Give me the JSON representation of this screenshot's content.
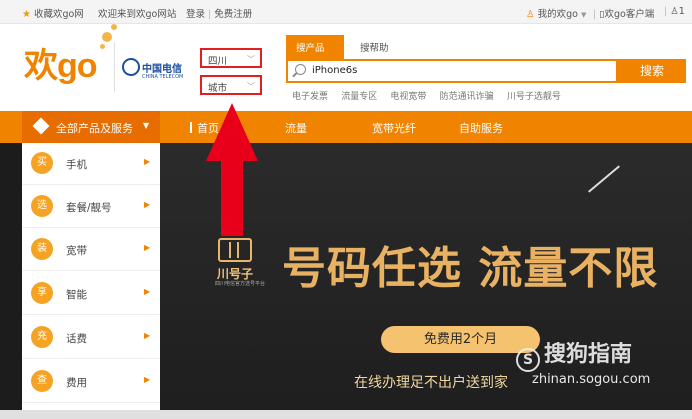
{
  "topbar": {
    "favorite": "收藏欢go网",
    "welcome": "欢迎来到欢go网站",
    "login": "登录",
    "register": "免费注册",
    "my_account": "我的欢go",
    "client": "欢go客户端",
    "right_fragment": "1"
  },
  "header": {
    "logo_text": "欢go",
    "telecom_cn": "中国电信",
    "telecom_en": "CHINA TELECOM",
    "province": "四川",
    "city": "城市"
  },
  "search": {
    "tabs": [
      "搜产品",
      "搜帮助"
    ],
    "value": "iPhone6s",
    "button": "搜索",
    "hot_words": [
      "电子发票",
      "流量专区",
      "电视宽带",
      "防范通讯诈骗",
      "川号子选靓号"
    ]
  },
  "nav": {
    "all": "全部产品及服务",
    "items": [
      "首页",
      "流量",
      "宽带光纤",
      "自助服务"
    ]
  },
  "sidebar": {
    "items": [
      {
        "badge": "买",
        "label": "手机"
      },
      {
        "badge": "选",
        "label": "套餐/靓号"
      },
      {
        "badge": "装",
        "label": "宽带"
      },
      {
        "badge": "享",
        "label": "智能"
      },
      {
        "badge": "充",
        "label": "话费"
      },
      {
        "badge": "查",
        "label": "费用"
      }
    ]
  },
  "banner": {
    "brand_name": "川号子",
    "brand_sub": "四川电信官方选号平台",
    "headline": "号码任选 流量不限",
    "pill": "免费用2个月",
    "sub": "在线办理足不出户送到家"
  },
  "watermark": {
    "name": "搜狗指南",
    "url": "zhinan.sogou.com"
  },
  "colors": {
    "accent": "#f08300",
    "arrow": "#e8001a",
    "banner_gold": "#e9b262"
  }
}
